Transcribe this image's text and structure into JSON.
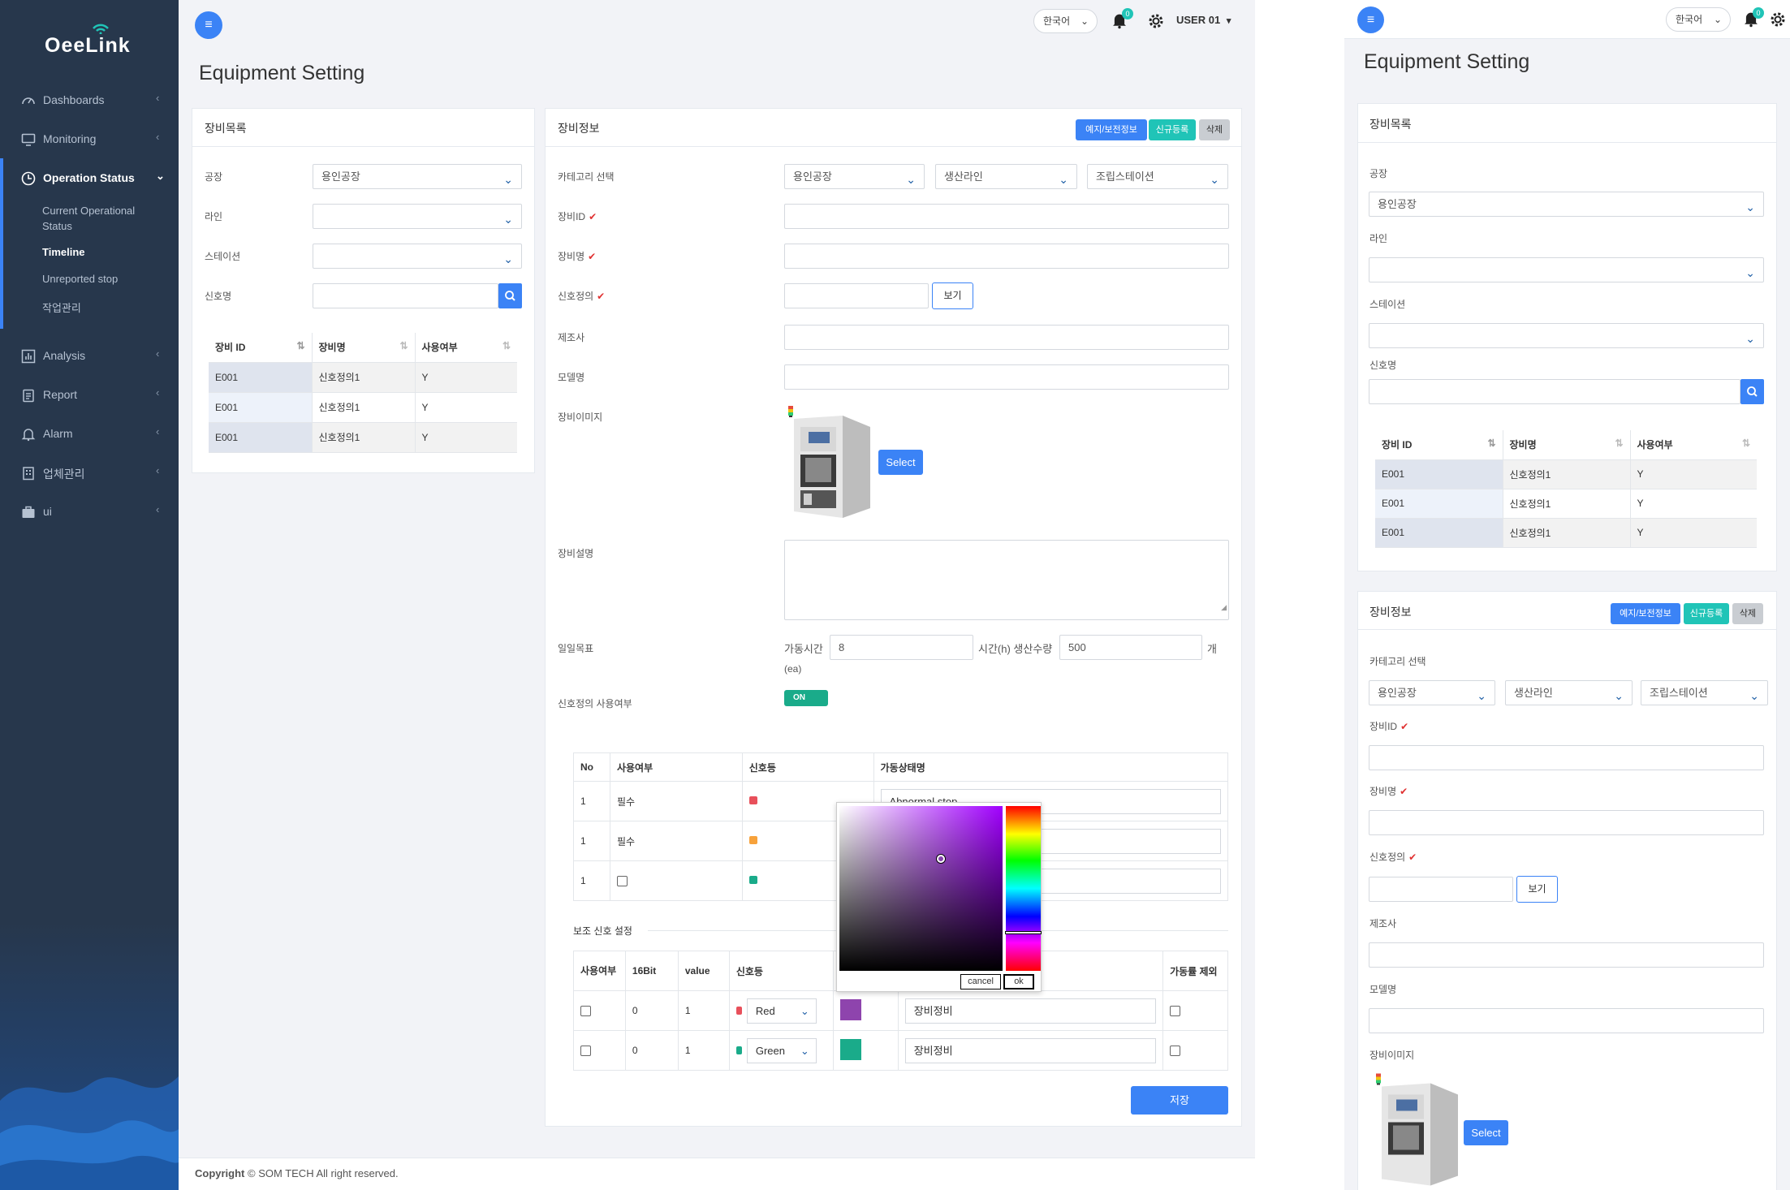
{
  "brand": {
    "logo": "OeeLink"
  },
  "sidebar": {
    "items": [
      {
        "label": "Dashboards",
        "icon": "gauge-icon"
      },
      {
        "label": "Monitoring",
        "icon": "monitor-icon"
      },
      {
        "label": "Operation Status",
        "icon": "clock-icon"
      },
      {
        "label": "Analysis",
        "icon": "chart-icon"
      },
      {
        "label": "Report",
        "icon": "clipboard-icon"
      },
      {
        "label": "Alarm",
        "icon": "bell-icon"
      },
      {
        "label": "업체관리",
        "icon": "building-icon"
      },
      {
        "label": "ui",
        "icon": "briefcase-icon"
      }
    ],
    "subitems": [
      {
        "label": "Current Operational Status"
      },
      {
        "label": "Timeline"
      },
      {
        "label": "Unreported stop"
      },
      {
        "label": "작업관리"
      }
    ]
  },
  "header": {
    "language": "한국어",
    "notifications": "0",
    "user": "USER 01"
  },
  "page": {
    "title": "Equipment Setting"
  },
  "list_panel": {
    "title": "장비목록",
    "factory_label": "공장",
    "factory_value": "용인공장",
    "line_label": "라인",
    "line_value": "",
    "station_label": "스테이션",
    "station_value": "",
    "signal_label": "신호명",
    "signal_value": "",
    "columns": [
      "장비 ID",
      "장비명",
      "사용여부"
    ],
    "rows": [
      [
        "E001",
        "신호정의1",
        "Y"
      ],
      [
        "E001",
        "신호정의1",
        "Y"
      ],
      [
        "E001",
        "신호정의1",
        "Y"
      ]
    ]
  },
  "info_panel": {
    "title": "장비정보",
    "btn_maintenance": "예지/보전정보",
    "btn_new": "신규등록",
    "btn_delete": "삭제",
    "category_label": "카테고리 선택",
    "category_factory": "용인공장",
    "category_line": "생산라인",
    "category_station": "조립스테이션",
    "equip_id_label": "장비ID",
    "equip_name_label": "장비명",
    "signal_def_label": "신호정의",
    "view_btn": "보기",
    "maker_label": "제조사",
    "model_label": "모델명",
    "image_label": "장비이미지",
    "select_btn": "Select",
    "desc_label": "장비설명",
    "daily_label": "일일목표",
    "op_time_label": "가동시간",
    "op_time_value": "8",
    "unit_hour": "시간(h) 생산수량",
    "qty_value": "500",
    "unit_ea": "개",
    "unit_ea2": "(ea)",
    "signal_use_label": "신호정의 사용여부",
    "toggle": "ON",
    "status_table": {
      "columns": [
        "No",
        "사용여부",
        "신호등",
        "가동상태명"
      ],
      "rows": [
        {
          "no": "1",
          "use": "필수",
          "color": "#e8505b",
          "name": "Abnormal stop"
        },
        {
          "no": "1",
          "use": "필수",
          "color": "#f7a23b",
          "name": ""
        },
        {
          "no": "1",
          "use": "",
          "color": "#1aab8a",
          "name": ""
        }
      ]
    },
    "aux_title": "보조 신호 설정",
    "aux_table": {
      "columns": [
        "사용여부",
        "16Bit",
        "value",
        "신호등",
        "",
        "",
        "가동률 제외"
      ],
      "rows": [
        {
          "bit": "0",
          "value": "1",
          "lamp": "Red",
          "lamp_color": "#e8505b",
          "swatch": "#8e44ad",
          "name": "장비정비"
        },
        {
          "bit": "0",
          "value": "1",
          "lamp": "Green",
          "lamp_color": "#1aab8a",
          "swatch": "#1aab8a",
          "name": "장비정비"
        }
      ]
    },
    "save_btn": "저장"
  },
  "color_picker": {
    "cancel": "cancel",
    "ok": "ok"
  },
  "footer": {
    "bold": "Copyright",
    "text": "© SOM TECH All right reserved."
  },
  "mobile": {
    "language": "한국어",
    "notifications": "0",
    "title": "Equipment Setting",
    "list_title": "장비목록",
    "factory_label": "공장",
    "factory_value": "용인공장",
    "line_label": "라인",
    "station_label": "스테이션",
    "signal_label": "신호명",
    "columns": [
      "장비 ID",
      "장비명",
      "사용여부"
    ],
    "rows": [
      [
        "E001",
        "신호정의1",
        "Y"
      ],
      [
        "E001",
        "신호정의1",
        "Y"
      ],
      [
        "E001",
        "신호정의1",
        "Y"
      ]
    ],
    "info_title": "장비정보",
    "btn_maintenance": "예지/보전정보",
    "btn_new": "신규등록",
    "btn_delete": "삭제",
    "category_label": "카테고리 선택",
    "category_factory": "용인공장",
    "category_line": "생산라인",
    "category_station": "조립스테이션",
    "equip_id_label": "장비ID",
    "equip_name_label": "장비명",
    "signal_def_label": "신호정의",
    "view_btn": "보기",
    "maker_label": "제조사",
    "model_label": "모델명",
    "image_label": "장비이미지",
    "select_btn": "Select"
  },
  "colors": {
    "sidebar": "#27374c",
    "accent": "#3b83f6",
    "teal": "#20c4b7",
    "green": "#1aab8a"
  }
}
